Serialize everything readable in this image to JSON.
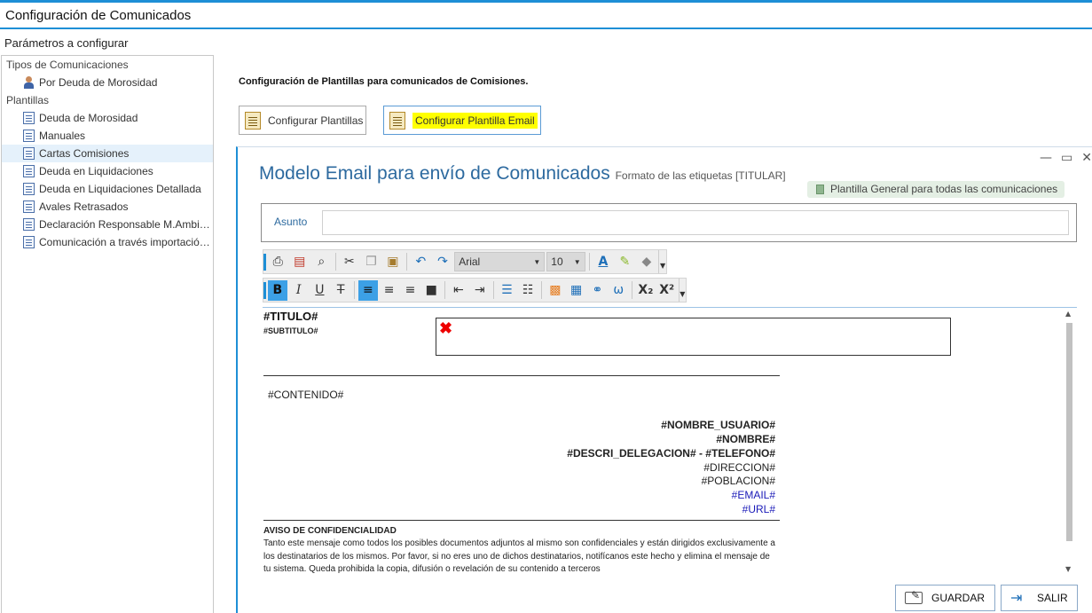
{
  "window": {
    "title": "Configuración de Comunicados"
  },
  "params_label": "Parámetros a configurar",
  "tree": {
    "groups": [
      {
        "label": "Tipos de Comunicaciones",
        "items": [
          "Por Deuda de Morosidad"
        ]
      },
      {
        "label": "Plantillas",
        "items": [
          "Deuda de Morosidad",
          "Manuales",
          "Cartas Comisiones",
          "Deuda en Liquidaciones",
          "Deuda en Liquidaciones Detallada",
          "Avales Retrasados",
          "Declaración Responsable M.Ambiente",
          "Comunicación a través importación E..."
        ]
      }
    ],
    "selected": "Cartas Comisiones"
  },
  "main": {
    "heading": "Configuración de Plantillas para comunicados de Comisiones.",
    "btn_configurar_plantillas": "Configurar Plantillas",
    "btn_configurar_email": "Configurar Plantilla Email"
  },
  "editor": {
    "title": "Modelo Email para envío de Comunicados",
    "format_note": "Formato de las etiquetas [TITULAR]",
    "general_tag": "Plantilla General para todas las comunicaciones",
    "subject_label": "Asunto",
    "subject_value": "",
    "font_name": "Arial",
    "font_size": "10",
    "doc": {
      "titulo": "#TITULO#",
      "subtitulo": "#SUBTITULO#",
      "contenido": "#CONTENIDO#",
      "sig_nombre_usuario": "#NOMBRE_USUARIO#",
      "sig_nombre": "#NOMBRE#",
      "sig_delegacion": "#DESCRI_DELEGACION# - #TELEFONO#",
      "sig_direccion": "#DIRECCION#",
      "sig_poblacion": "#POBLACION#",
      "sig_email": "#EMAIL#",
      "sig_url": "#URL#",
      "aviso_title": "AVISO DE CONFIDENCIALIDAD",
      "aviso_text": "Tanto este mensaje como todos los posibles documentos adjuntos al mismo son confidenciales y están dirigidos exclusivamente a los destinatarios de los mismos. Por favor, si no eres uno de dichos destinatarios, notifícanos este hecho y elimina el mensaje de tu sistema. Queda prohibida la copia, difusión o revelación de su contenido a terceros"
    },
    "btn_guardar": "GUARDAR",
    "btn_salir": "SALIR"
  },
  "colors": {
    "accent": "#1e8fd6",
    "highlight": "#ffff00",
    "title_blue": "#2d6a9f",
    "link_blue": "#1a1ab8"
  }
}
